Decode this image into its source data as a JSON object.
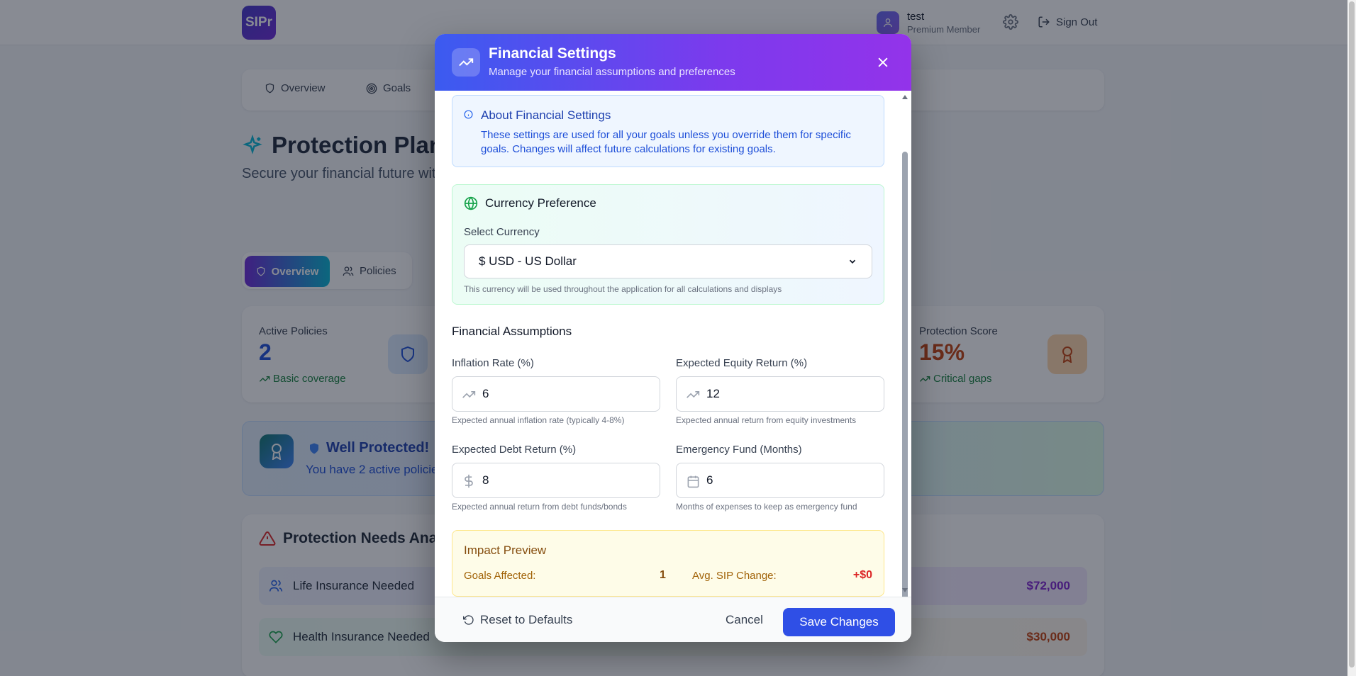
{
  "header": {
    "logo_text": "SIPr",
    "user_name": "test",
    "user_role": "Premium Member",
    "sign_out": "Sign Out"
  },
  "nav": {
    "items": [
      "Overview",
      "Goals"
    ]
  },
  "page": {
    "title": "Protection Plann",
    "subtitle": "Secure your financial future with"
  },
  "tabs": {
    "overview": "Overview",
    "policies": "Policies"
  },
  "stats": {
    "active_label": "Active Policies",
    "active_value": "2",
    "active_note": "Basic coverage",
    "score_label": "Protection Score",
    "score_value": "15%",
    "score_note": "Critical gaps"
  },
  "banner": {
    "title": "Well Protected!",
    "text": "You have 2 active policie"
  },
  "needs": {
    "title": "Protection Needs Anal",
    "rows": [
      {
        "label": "Life Insurance Needed",
        "amount": "$72,000"
      },
      {
        "label": "Health Insurance Needed",
        "amount": "$30,000"
      }
    ]
  },
  "modal": {
    "title": "Financial Settings",
    "subtitle": "Manage your financial assumptions and preferences",
    "about": {
      "title": "About Financial Settings",
      "text": "These settings are used for all your goals unless you override them for specific goals. Changes will affect future calculations for existing goals."
    },
    "currency": {
      "title": "Currency Preference",
      "label": "Select Currency",
      "selected": "$ USD - US Dollar",
      "hint": "This currency will be used throughout the application for all calculations and displays"
    },
    "assumptions": {
      "title": "Financial Assumptions",
      "inflation": {
        "label": "Inflation Rate (%)",
        "value": "6",
        "hint": "Expected annual inflation rate (typically 4-8%)"
      },
      "equity": {
        "label": "Expected Equity Return (%)",
        "value": "12",
        "hint": "Expected annual return from equity investments"
      },
      "debt": {
        "label": "Expected Debt Return (%)",
        "value": "8",
        "hint": "Expected annual return from debt funds/bonds"
      },
      "emergency": {
        "label": "Emergency Fund (Months)",
        "value": "6",
        "hint": "Months of expenses to keep as emergency fund"
      }
    },
    "impact": {
      "title": "Impact Preview",
      "goals_label": "Goals Affected:",
      "goals_value": "1",
      "sip_label": "Avg. SIP Change:",
      "sip_value": "+$0"
    },
    "footer": {
      "reset": "Reset to Defaults",
      "cancel": "Cancel",
      "save": "Save Changes"
    }
  },
  "colors": {
    "accent": "#2f4fe6",
    "header_gradient_start": "#3b5bf0",
    "header_gradient_end": "#9333ea",
    "score_color": "#c2410c",
    "positive_note": "#15803d"
  }
}
